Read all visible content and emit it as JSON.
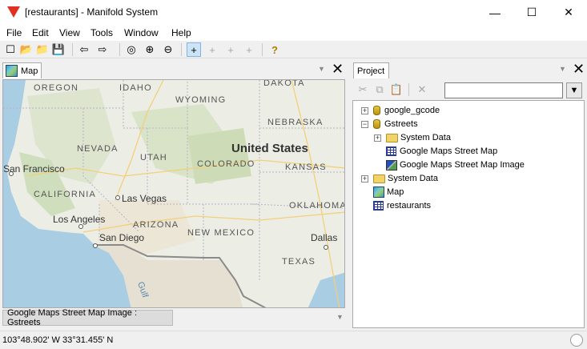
{
  "window": {
    "title": "[restaurants] - Manifold System",
    "minimize_glyph": "—",
    "maximize_glyph": "☐",
    "close_glyph": "✕"
  },
  "menu": [
    "File",
    "Edit",
    "View",
    "Tools",
    "Window",
    "Help"
  ],
  "toolbar": [
    {
      "icon": "new-icon",
      "glyph": "☐"
    },
    {
      "icon": "open-icon",
      "glyph": "📂"
    },
    {
      "icon": "open-folder-icon",
      "glyph": "📁"
    },
    {
      "icon": "save-icon",
      "glyph": "💾"
    },
    {
      "icon": "back-icon",
      "glyph": "⇦"
    },
    {
      "icon": "forward-icon",
      "glyph": "⇨"
    },
    {
      "icon": "zoom-fit-icon",
      "glyph": "◎"
    },
    {
      "icon": "zoom-in-icon",
      "glyph": "⊕"
    },
    {
      "icon": "zoom-out-icon",
      "glyph": "⊖"
    },
    {
      "icon": "pointer-crosshair-icon",
      "glyph": "+"
    },
    {
      "icon": "add-point-icon",
      "glyph": "+"
    },
    {
      "icon": "add-line-icon",
      "glyph": "+"
    },
    {
      "icon": "add-area-icon",
      "glyph": "+"
    },
    {
      "icon": "help-icon",
      "glyph": "?"
    }
  ],
  "map_pane": {
    "tab_label": "Map",
    "layer_tab": "Google Maps Street Map Image : Gstreets",
    "labels": {
      "oregon": "OREGON",
      "idaho": "IDAHO",
      "dakota": "DAKOTA",
      "wyoming": "WYOMING",
      "nebraska": "NEBRASKA",
      "nevada": "NEVADA",
      "utah": "UTAH",
      "united_states": "United States",
      "colorado": "COLORADO",
      "kansas": "KANSAS",
      "san_francisco": "San Francisco",
      "california": "CALIFORNIA",
      "las_vegas": "Las Vegas",
      "oklahoma": "OKLAHOMA",
      "los_angeles": "Los Angeles",
      "arizona": "ARIZONA",
      "san_diego": "San Diego",
      "new_mexico": "NEW MEXICO",
      "dallas": "Dallas",
      "texas": "TEXAS",
      "gulf": "Gulf"
    }
  },
  "project_pane": {
    "tab_label": "Project",
    "search_value": "",
    "tree": [
      {
        "label": "google_gcode",
        "icon": "database-icon",
        "expander": "+",
        "level": 0
      },
      {
        "label": "Gstreets",
        "icon": "database-icon",
        "expander": "−",
        "level": 0
      },
      {
        "label": "System Data",
        "icon": "folder-icon",
        "expander": "+",
        "level": 1
      },
      {
        "label": "Google Maps Street Map",
        "icon": "table-icon",
        "expander": "",
        "level": 1
      },
      {
        "label": "Google Maps Street Map Image",
        "icon": "image-icon",
        "expander": "",
        "level": 1
      },
      {
        "label": "System Data",
        "icon": "folder-icon",
        "expander": "+",
        "level": 0
      },
      {
        "label": "Map",
        "icon": "map-icon",
        "expander": "",
        "level": 0
      },
      {
        "label": "restaurants",
        "icon": "table-icon",
        "expander": "",
        "level": 0
      }
    ]
  },
  "status": {
    "coordinates": "103°48.902' W 33°31.455' N"
  }
}
